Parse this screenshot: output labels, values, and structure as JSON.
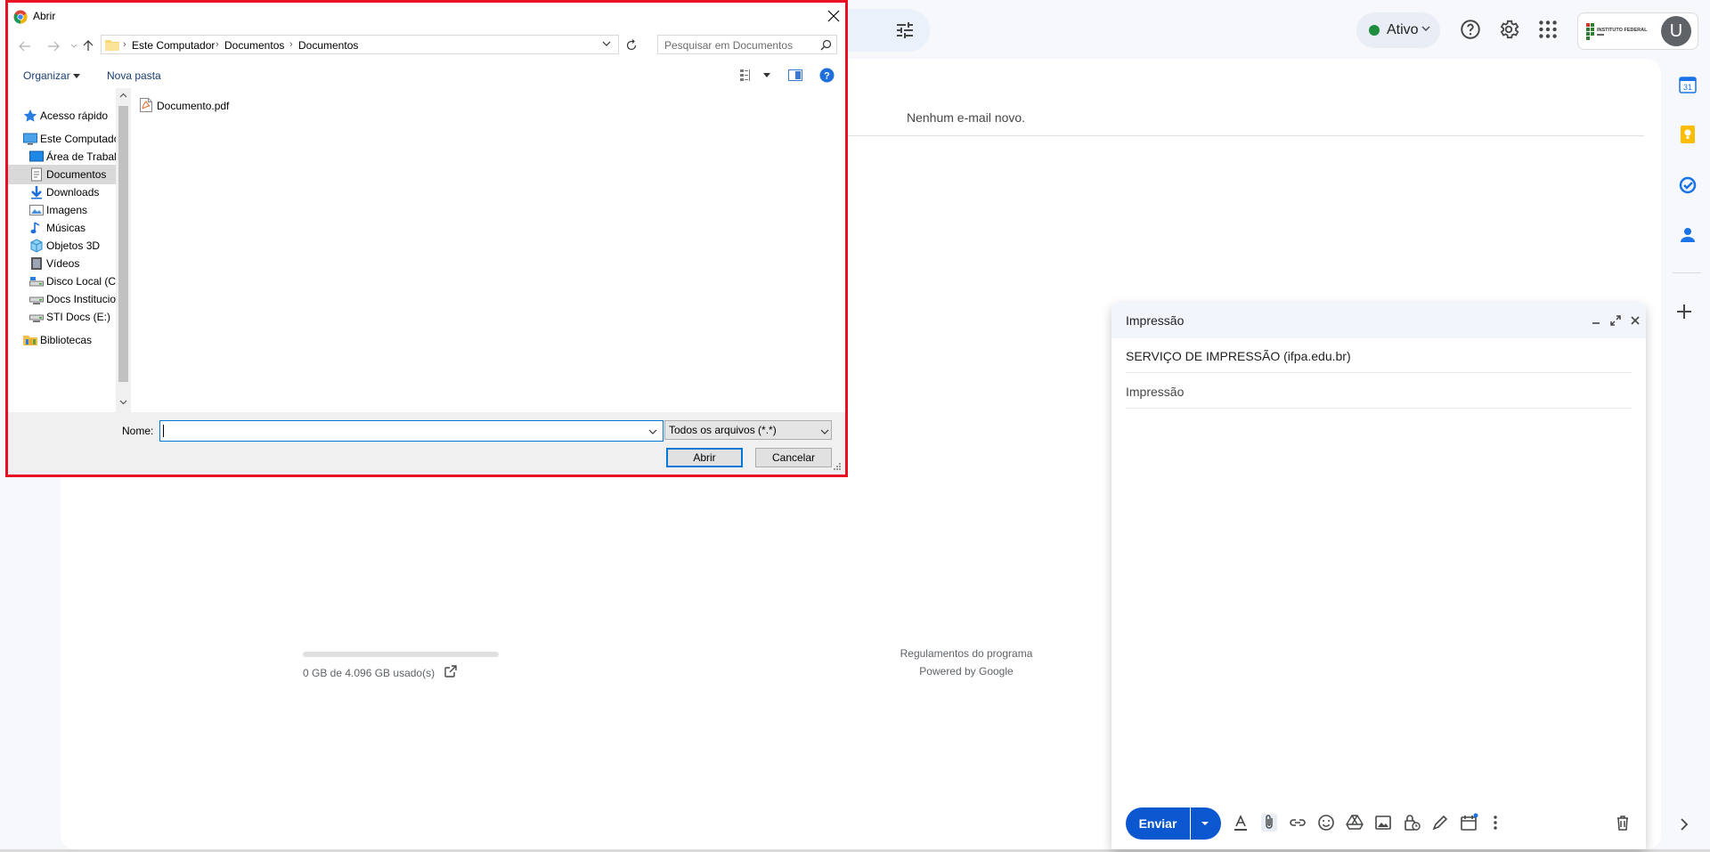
{
  "gmail": {
    "status_label": "Ativo",
    "avatar_letter": "U",
    "no_new_mail": "Nenhum e-mail novo.",
    "storage_text": "0 GB de 4.096 GB usado(s)",
    "program_policies": "Regulamentos do programa",
    "powered_by": "Powered by Google",
    "org_logo_text": "INSTITUTO FEDERAL",
    "status_color": "#1e8e3e",
    "accent": "#0b57d0"
  },
  "compose": {
    "title": "Impressão",
    "to": "SERVIÇO DE IMPRESSÃO (ifpa.edu.br)",
    "subject": "Impressão",
    "send_label": "Enviar",
    "toolbar_icons": [
      "text-format-icon",
      "attach-icon",
      "link-icon",
      "emoji-icon",
      "drive-icon",
      "photo-icon",
      "lock-clock-icon",
      "signature-icon",
      "schedule-icon",
      "more-options-icon",
      "trash-icon"
    ]
  },
  "dialog": {
    "title": "Abrir",
    "address": {
      "crumbs": [
        "Este Computador",
        "Documentos",
        "Documentos"
      ]
    },
    "search_placeholder": "Pesquisar em Documentos",
    "toolbar": {
      "organize": "Organizar",
      "new_folder": "Nova pasta"
    },
    "nav_items": [
      {
        "label": "Acesso rápido",
        "icon": "star-icon"
      },
      {
        "label": "Este Computador",
        "icon": "computer-icon"
      },
      {
        "label": "Área de Trabalho",
        "icon": "desktop-icon"
      },
      {
        "label": "Documentos",
        "icon": "documents-icon",
        "selected": true
      },
      {
        "label": "Downloads",
        "icon": "download-icon"
      },
      {
        "label": "Imagens",
        "icon": "pictures-icon"
      },
      {
        "label": "Músicas",
        "icon": "music-icon"
      },
      {
        "label": "Objetos 3D",
        "icon": "cube-icon"
      },
      {
        "label": "Vídeos",
        "icon": "video-icon"
      },
      {
        "label": "Disco Local (C:)",
        "icon": "drive-c-icon"
      },
      {
        "label": "Docs Institucionais",
        "icon": "network-drive-icon"
      },
      {
        "label": "STI Docs (E:)",
        "icon": "network-drive-icon"
      },
      {
        "label": "Bibliotecas",
        "icon": "library-icon"
      }
    ],
    "files": [
      {
        "name": "Documento.pdf",
        "icon": "pdf-file-icon"
      }
    ],
    "name_label": "Nome:",
    "name_value": "",
    "file_type": "Todos os arquivos (*.*)",
    "open_label": "Abrir",
    "cancel_label": "Cancelar",
    "frame_color": "#e81123"
  }
}
